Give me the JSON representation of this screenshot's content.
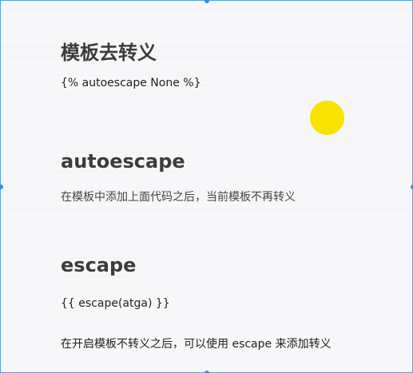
{
  "colors": {
    "accent_dot": "#f7e200",
    "selection": "#2f8ff0"
  },
  "section_template_escape": {
    "title": "模板去转义",
    "code": "{% autoescape None %}"
  },
  "section_autoescape": {
    "title": "autoescape",
    "description": "在模板中添加上面代码之后，当前模板不再转义"
  },
  "section_escape": {
    "title": "escape",
    "code": "{{ escape(atga) }}",
    "description": "在开启模板不转义之后，可以使用 escape 来添加转义"
  }
}
